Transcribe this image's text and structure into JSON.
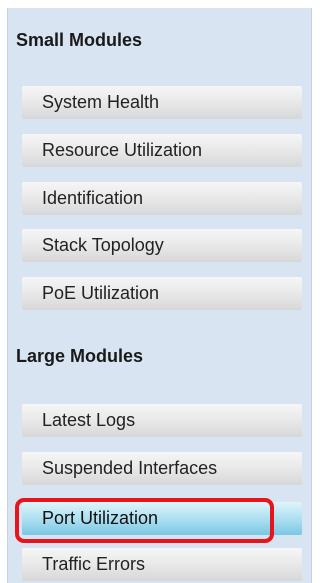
{
  "small_modules": {
    "title": "Small Modules",
    "items": [
      {
        "label": "System Health"
      },
      {
        "label": "Resource Utilization"
      },
      {
        "label": "Identification"
      },
      {
        "label": "Stack Topology"
      },
      {
        "label": "PoE Utilization"
      }
    ]
  },
  "large_modules": {
    "title": "Large Modules",
    "items": [
      {
        "label": "Latest Logs"
      },
      {
        "label": "Suspended Interfaces"
      },
      {
        "label": "Port Utilization",
        "selected": true
      },
      {
        "label": "Traffic Errors"
      }
    ]
  },
  "colors": {
    "panel_background": "#d8e4f1",
    "selected_item": "#a9def0",
    "highlight_outline": "#e8141b"
  }
}
